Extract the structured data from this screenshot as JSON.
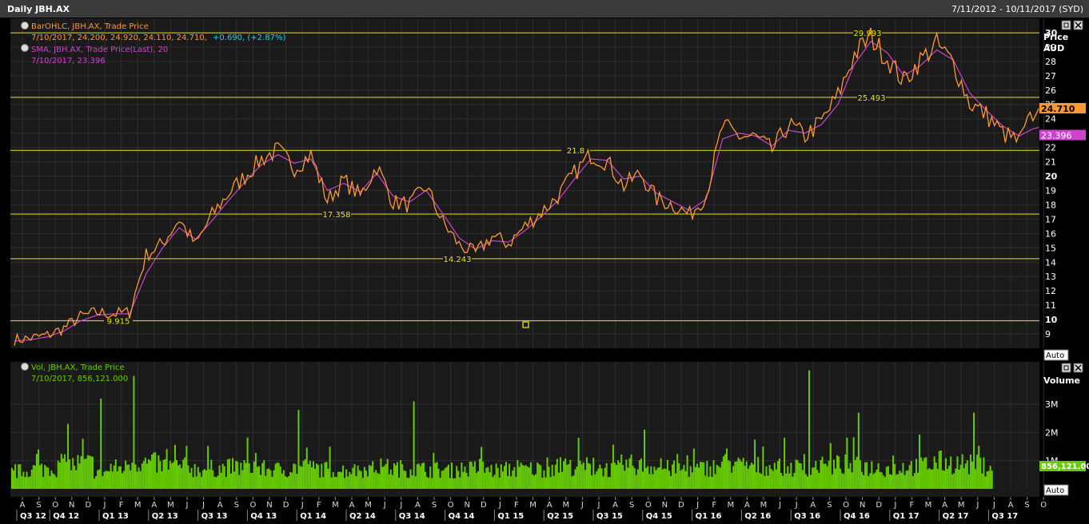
{
  "header": {
    "title": "Daily JBH.AX",
    "date_range": "7/11/2012 - 10/11/2017 (SYD)"
  },
  "price_panel": {
    "legend_ohlc_line1": "BarOHLC, JBH.AX, Trade Price",
    "legend_ohlc_line2": "7/10/2017, 24.200, 24.920, 24.110, 24.710,",
    "legend_ohlc_change": "+0.690, (+2.87%)",
    "legend_sma_line1": "SMA, JBH.AX, Trade Price(Last), 20",
    "legend_sma_line2": "7/10/2017, 23.396",
    "axis_title": "Price",
    "axis_unit": "AUD",
    "last_price_label": "24.710",
    "last_sma_label": "23.396",
    "auto_button": "Auto"
  },
  "volume_panel": {
    "legend_line1": "Vol, JBH.AX, Trade Price",
    "legend_line2": "7/10/2017, 856,121.000",
    "axis_title": "Volume",
    "last_volume_label": "856,121.00",
    "auto_button": "Auto"
  },
  "colors": {
    "background": "#1a1a1a",
    "grid": "#2e2e2e",
    "price_line": "#ff9933",
    "sma_line": "#cc44cc",
    "support_line": "#e6e600",
    "volume_bars": "#66cc00",
    "change_positive": "#00e0e0"
  },
  "chart_data": [
    {
      "type": "line",
      "title": "Daily JBH.AX",
      "ylabel": "Price AUD",
      "ylim": [
        8,
        31
      ],
      "yticks": [
        9,
        10,
        11,
        12,
        13,
        14,
        15,
        16,
        17,
        18,
        19,
        20,
        21,
        22,
        23,
        24,
        25,
        26,
        27,
        28,
        29,
        30
      ],
      "grid": true,
      "x_months": [
        "A",
        "S",
        "O",
        "N",
        "D",
        "J",
        "F",
        "M",
        "A",
        "M",
        "J",
        "J",
        "A",
        "S",
        "O",
        "N",
        "D",
        "J",
        "F",
        "M",
        "A",
        "M",
        "J",
        "J",
        "A",
        "S",
        "O",
        "N",
        "D",
        "J",
        "F",
        "M",
        "A",
        "M",
        "J",
        "J",
        "A",
        "S",
        "O",
        "N",
        "D",
        "J",
        "F",
        "M",
        "A",
        "M",
        "J",
        "J",
        "A",
        "S",
        "O",
        "N",
        "D",
        "J",
        "F",
        "M",
        "A",
        "M",
        "J",
        "J",
        "A",
        "S",
        "O"
      ],
      "x_quarters": [
        "Q3 12",
        "Q4 12",
        "Q1 13",
        "Q2 13",
        "Q3 13",
        "Q4 13",
        "Q1 14",
        "Q2 14",
        "Q3 14",
        "Q4 14",
        "Q1 15",
        "Q2 15",
        "Q3 15",
        "Q4 15",
        "Q1 16",
        "Q2 16",
        "Q3 16",
        "Q4 16",
        "Q1 17",
        "Q2 17",
        "Q3 17"
      ],
      "series": [
        {
          "name": "BarOHLC, JBH.AX, Trade Price",
          "monthly_close": [
            8.6,
            8.7,
            8.9,
            9.4,
            10.2,
            10.5,
            10.4,
            10.5,
            14.5,
            15.3,
            17.0,
            15.2,
            17.3,
            18.8,
            20.0,
            21.2,
            21.8,
            20.6,
            21.5,
            18.3,
            19.7,
            18.6,
            20.7,
            18.2,
            18.0,
            19.3,
            16.8,
            15.2,
            14.6,
            15.8,
            15.3,
            16.5,
            17.5,
            18.6,
            20.2,
            21.5,
            21.0,
            19.3,
            20.2,
            18.4,
            18.0,
            17.3,
            18.7,
            23.5,
            22.8,
            22.7,
            21.8,
            23.6,
            22.8,
            23.8,
            25.6,
            28.5,
            29.7,
            28.2,
            26.6,
            28.1,
            29.2,
            27.9,
            25.1,
            24.3,
            23.0,
            22.4,
            24.7
          ]
        },
        {
          "name": "SMA, JBH.AX, Trade Price(Last), 20",
          "monthly_value": [
            8.5,
            8.6,
            8.8,
            9.2,
            9.9,
            10.3,
            10.4,
            10.4,
            13.2,
            15.0,
            16.4,
            15.6,
            16.9,
            18.3,
            19.6,
            20.8,
            21.5,
            20.9,
            21.2,
            19.0,
            19.5,
            18.9,
            20.2,
            18.6,
            18.2,
            19.0,
            17.4,
            15.7,
            14.9,
            15.5,
            15.4,
            16.2,
            17.2,
            18.3,
            19.8,
            21.2,
            21.1,
            19.8,
            20.0,
            18.8,
            18.2,
            17.6,
            18.4,
            22.6,
            23.0,
            22.8,
            22.1,
            23.2,
            23.0,
            23.6,
            25.0,
            27.8,
            29.4,
            28.6,
            27.0,
            27.7,
            28.8,
            28.1,
            25.8,
            24.6,
            23.5,
            22.8,
            23.4
          ]
        }
      ],
      "horizontal_lines": [
        {
          "value": 9.915,
          "label": "9.915"
        },
        {
          "value": 14.243,
          "label": "14.243"
        },
        {
          "value": 17.358,
          "label": "17.358"
        },
        {
          "value": 21.8,
          "label": "21.8"
        },
        {
          "value": 25.493,
          "label": "25.493"
        },
        {
          "value": 29.993,
          "label": "29.993"
        }
      ],
      "last_value": 24.71,
      "last_sma": 23.396
    },
    {
      "type": "bar",
      "title": "Vol, JBH.AX, Trade Price",
      "ylabel": "Volume",
      "ylim": [
        0,
        4500000
      ],
      "yticks": [
        {
          "value": 1000000,
          "label": "1M"
        },
        {
          "value": 2000000,
          "label": "2M"
        },
        {
          "value": 3000000,
          "label": "3M"
        }
      ],
      "grid": true,
      "monthly_avg_volume": [
        620000,
        700000,
        750000,
        850000,
        900000,
        620000,
        750000,
        950000,
        900000,
        820000,
        780000,
        700000,
        720000,
        760000,
        820000,
        700000,
        680000,
        750000,
        720000,
        680000,
        650000,
        700000,
        760000,
        720000,
        700000,
        680000,
        650000,
        700000,
        720000,
        650000,
        680000,
        700000,
        720000,
        760000,
        800000,
        750000,
        700000,
        850000,
        800000,
        720000,
        700000,
        700000,
        760000,
        900000,
        820000,
        800000,
        780000,
        750000,
        780000,
        800000,
        850000,
        800000,
        760000,
        720000,
        780000,
        850000,
        950000,
        900000,
        850000,
        800000,
        780000
      ],
      "spikes": [
        {
          "month_index": 3,
          "value": 2300000
        },
        {
          "month_index": 5,
          "value": 3200000
        },
        {
          "month_index": 7,
          "value": 4000000
        },
        {
          "month_index": 17,
          "value": 2800000
        },
        {
          "month_index": 24,
          "value": 3100000
        },
        {
          "month_index": 38,
          "value": 2100000
        },
        {
          "month_index": 48,
          "value": 4200000
        },
        {
          "month_index": 51,
          "value": 2700000
        },
        {
          "month_index": 58,
          "value": 2700000
        }
      ],
      "last_value": 856121
    }
  ]
}
